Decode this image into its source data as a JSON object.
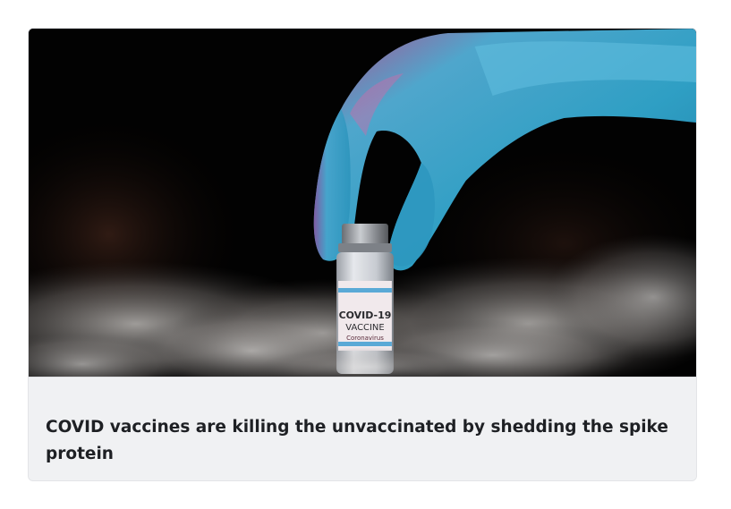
{
  "card": {
    "image_subject": "gloved-hand-holding-vaccine-vial",
    "vial_label": {
      "line1": "COVID-19",
      "line2": "VACCINE",
      "line3": "Coronavirus"
    },
    "headline": "COVID vaccines are killing the unvaccinated by shedding the spike protein"
  },
  "colors": {
    "glove": "#3aa7c7",
    "background": "#000000",
    "caption_background": "#f0f1f3",
    "headline_text": "#1e2024"
  }
}
